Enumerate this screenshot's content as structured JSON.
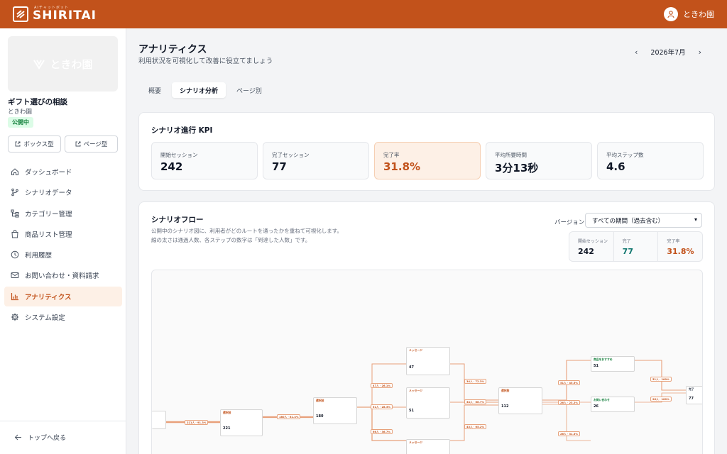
{
  "header": {
    "logo_sub": "AIチャットボット",
    "logo_text": "SHIRITAI",
    "user_name": "ときわ園"
  },
  "sidebar": {
    "thumb_text": "ときわ園",
    "bot_title": "ギフト選びの相談",
    "bot_owner": "ときわ園",
    "status": "公開中",
    "box_type_label": "ボックス型",
    "page_type_label": "ページ型",
    "items": [
      {
        "label": "ダッシュボード",
        "icon": "home-icon"
      },
      {
        "label": "シナリオデータ",
        "icon": "branch-icon"
      },
      {
        "label": "カテゴリー管理",
        "icon": "tree-icon"
      },
      {
        "label": "商品リスト管理",
        "icon": "bag-icon"
      },
      {
        "label": "利用履歴",
        "icon": "clock-icon"
      },
      {
        "label": "お問い合わせ・資料請求",
        "icon": "mail-icon"
      },
      {
        "label": "アナリティクス",
        "icon": "bar-chart-icon"
      },
      {
        "label": "システム設定",
        "icon": "gear-icon"
      }
    ],
    "back_label": "トップへ戻る"
  },
  "main": {
    "title": "アナリティクス",
    "subtitle": "利用状況を可視化して改善に役立てましょう",
    "month": "2026年7月",
    "tabs": [
      "概要",
      "シナリオ分析",
      "ページ別"
    ],
    "active_tab": 1
  },
  "kpi": {
    "title": "シナリオ進行 KPI",
    "items": [
      {
        "label": "開始セッション",
        "value": "242"
      },
      {
        "label": "完了セッション",
        "value": "77"
      },
      {
        "label": "完了率",
        "value": "31.8%"
      },
      {
        "label": "平均所要時間",
        "value": "3分13秒"
      },
      {
        "label": "平均ステップ数",
        "value": "4.6"
      }
    ]
  },
  "flow": {
    "title": "シナリオフロー",
    "desc_line1": "公開中のシナリオ図に、利用者がどのルートを通ったかを重ねて可視化します。",
    "desc_line2": "線の太さは通過人数、各ステップの数字は「到達した人数」です。",
    "version_label": "バージョン",
    "version_value": "すべての期間（過去含む）",
    "mini_stats": [
      {
        "label": "開始セッション",
        "value": "242"
      },
      {
        "label": "完了",
        "value": "77"
      },
      {
        "label": "完了率",
        "value": "31.8%"
      }
    ],
    "edge_labels": [
      "221人 · 91.3%",
      "180人 · 81.4%",
      "47人 · 26.1%",
      "51人 · 28.3%",
      "66人 · 36.7%",
      "34人 · 72.3%",
      "34人 · 66.7%",
      "43人 · 65.2%",
      "51人 · 45.5%",
      "26人 · 23.2%",
      "26人 · 31.3%",
      "51人 · 100%",
      "26人 · 100%"
    ],
    "node_counts": [
      "221",
      "180",
      "47",
      "51",
      "112",
      "51",
      "26",
      "77"
    ],
    "node_types": [
      "選択肢",
      "選択肢",
      "メッセージ",
      "メッセージ",
      "選択肢",
      "商品をおすすめ",
      "お問い合わせ",
      "完了"
    ]
  }
}
